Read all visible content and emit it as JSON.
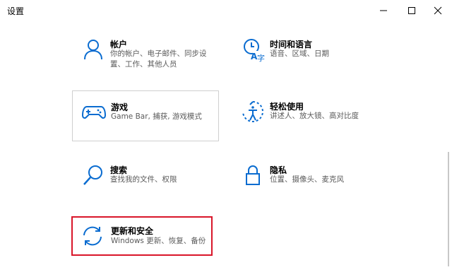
{
  "window": {
    "title": "设置",
    "minimize_glyph": "minimize-icon",
    "maximize_glyph": "maximize-icon",
    "close_glyph": "close-icon"
  },
  "colors": {
    "accent": "#0a6cd0",
    "selection_border": "#d9162a",
    "hover_border": "#cfcfcf",
    "description_text": "#5a5a5a"
  },
  "tiles": {
    "accounts": {
      "title": "帐户",
      "desc_line1": "你的帐户、电子邮件、同步设",
      "desc_line2": "置、工作、其他人员",
      "icon": "person-icon"
    },
    "time_language": {
      "title": "时间和语言",
      "desc_line1": "语音、区域、日期",
      "icon": "time-language-icon"
    },
    "gaming": {
      "title": "游戏",
      "desc_line1": "Game Bar, 捕获, 游戏模式",
      "icon": "gamepad-icon"
    },
    "ease_of_access": {
      "title": "轻松使用",
      "desc_line1": "讲述人、放大镜、高对比度",
      "icon": "ease-of-access-icon"
    },
    "search": {
      "title": "搜索",
      "desc_line1": "查找我的文件、权限",
      "icon": "search-icon"
    },
    "privacy": {
      "title": "隐私",
      "desc_line1": "位置、摄像头、麦克风",
      "icon": "lock-icon"
    },
    "update_security": {
      "title": "更新和安全",
      "desc_line1": "Windows 更新、恢复、备份",
      "icon": "sync-icon"
    }
  }
}
